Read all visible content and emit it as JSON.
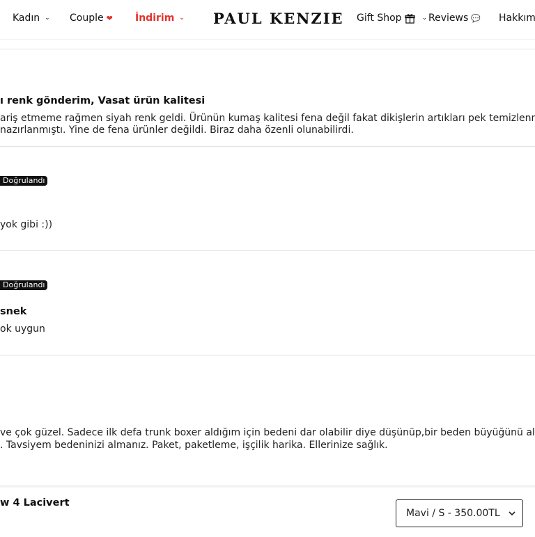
{
  "nav": {
    "left": [
      {
        "label": "Kadın",
        "icon": "chevron-down-icon"
      },
      {
        "label": "Couple",
        "icon": "heart-icon"
      },
      {
        "label": "İndirim",
        "icon": "chevron-down-icon"
      }
    ],
    "logo": "PAUL KENZIE",
    "right": [
      {
        "label": "Gift Shop",
        "icon": "gift-icon"
      },
      {
        "label": "Reviews",
        "icon": "speech-bubble-icon"
      },
      {
        "label": "Hakkım"
      }
    ]
  },
  "reviews": [
    {
      "title": "ı renk gönderim, Vasat ürün kalitesi",
      "lines": [
        "ariş etmeme rağmen siyah renk geldi. Ürünün kumaş kalitesi fena değil fakat dikişlerin artıkları pek temizlenmem",
        "nazırlanmıştı. Yine de fena ürünler değildi. Biraz daha özenli olunabilirdi."
      ]
    },
    {
      "badge": "Doğrulandı",
      "lines": [
        "yok gibi :))"
      ]
    },
    {
      "badge": "Doğrulandı",
      "title": "snek",
      "lines": [
        "ok uygun"
      ]
    },
    {
      "lines": [
        "ve çok güzel. Sadece ilk defa trunk boxer aldığım için bedeni dar olabilir diye düşünüp,bir beden büyüğünü aldı",
        ". Tavsiyem bedeninizi almanız. Paket, paketleme, işçilik harika. Ellerinize sağlık."
      ]
    }
  ],
  "bottom_bar": {
    "product_name": "w 4 Lacivert",
    "variant_value": "Mavi / S - 350.00TL",
    "variant_icon": "chevron-down-icon"
  },
  "colors": {
    "sale_red": "#e4322b",
    "badge_bg": "#111111"
  }
}
